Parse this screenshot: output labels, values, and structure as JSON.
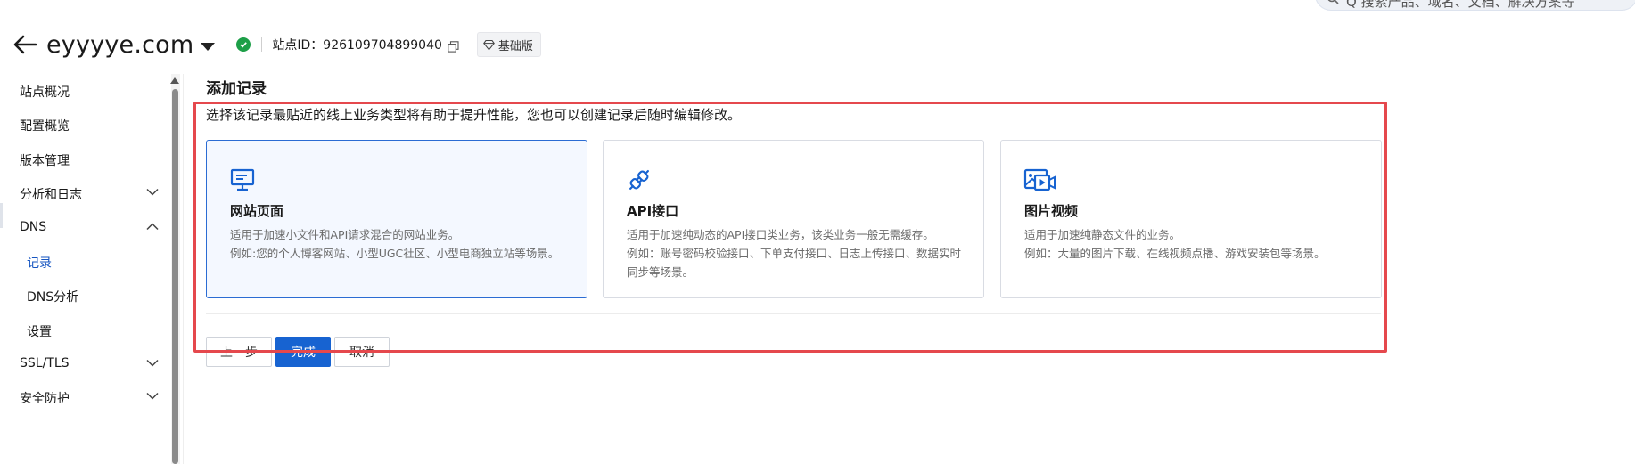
{
  "header": {
    "site_name": "eyyyye.com",
    "site_id_label": "站点ID：926109704899040",
    "plan": "基础版"
  },
  "search": {
    "text": "Q 搜索产品、域名、文档、解决方案等"
  },
  "sidebar": {
    "items": [
      {
        "label": "站点概况"
      },
      {
        "label": "配置概览"
      },
      {
        "label": "版本管理"
      },
      {
        "label": "分析和日志"
      },
      {
        "label": "DNS"
      },
      {
        "label": "记录"
      },
      {
        "label": "DNS分析"
      },
      {
        "label": "设置"
      },
      {
        "label": "SSL/TLS"
      },
      {
        "label": "安全防护"
      }
    ]
  },
  "main": {
    "title": "添加记录",
    "description": "选择该记录最贴近的线上业务类型将有助于提升性能，您也可以创建记录后随时编辑修改。",
    "cards": [
      {
        "name": "网站页面",
        "desc1": "适用于加速小文件和API请求混合的网站业务。",
        "desc2": "例如:您的个人博客网站、小型UGC社区、小型电商独立站等场景。"
      },
      {
        "name": "API接口",
        "desc1": "适用于加速纯动态的API接口类业务，该类业务一般无需缓存。",
        "desc2": "例如：账号密码校验接口、下单支付接口、日志上传接口、数据实时同步等场景。"
      },
      {
        "name": "图片视频",
        "desc1": "适用于加速纯静态文件的业务。",
        "desc2": "例如：大量的图片下载、在线视频点播、游戏安装包等场景。"
      }
    ],
    "buttons": {
      "prev": "上一步",
      "done": "完成",
      "cancel": "取消"
    }
  },
  "colors": {
    "accent": "#1763d1",
    "highlight": "#e5484d",
    "ok": "#1d9f48"
  }
}
